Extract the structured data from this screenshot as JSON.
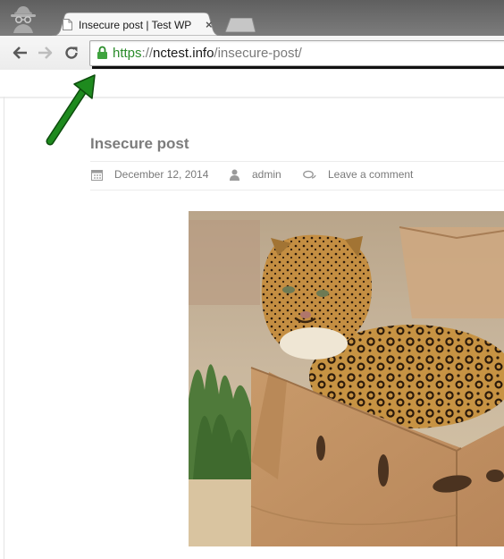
{
  "browser": {
    "tab": {
      "title": "Insecure post | Test WP",
      "close_glyph": "×"
    },
    "address_bar": {
      "scheme": "https",
      "separator": "://",
      "host": "nctest.info",
      "path": "/insecure-post/"
    },
    "icons": {
      "incognito": "incognito-icon",
      "back": "back-arrow-icon",
      "forward": "forward-arrow-icon",
      "reload": "reload-icon",
      "lock": "lock-icon",
      "page": "page-icon"
    },
    "colors": {
      "secure_green": "#2a8c2a",
      "annotation_arrow": "#1e8a1e"
    }
  },
  "post": {
    "title": "Insecure post",
    "meta": {
      "date": "December 12, 2014",
      "author": "admin",
      "comments_link": "Leave a comment"
    },
    "image": {
      "subject": "leopard lying in a cardboard box"
    }
  }
}
